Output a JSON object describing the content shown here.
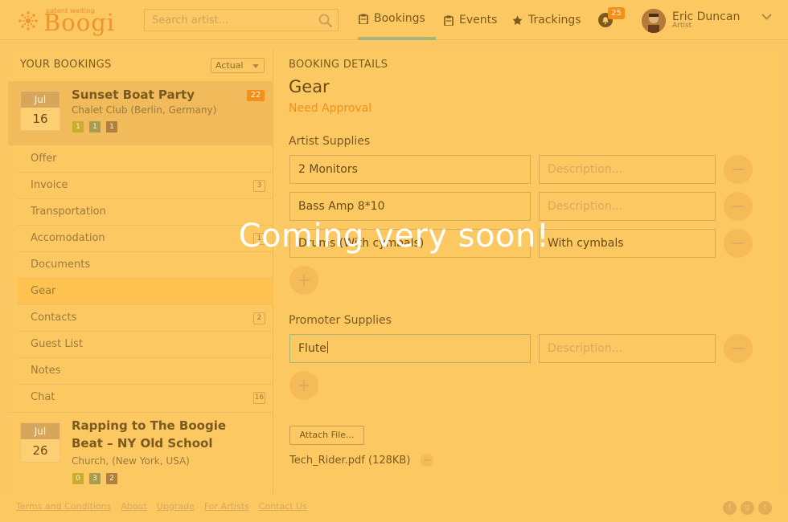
{
  "app": {
    "brand": "Boogi",
    "brand_tag": "patent waiting",
    "brand_color": "#f0932e",
    "accent_color": "#f39019",
    "overlay_text": "Coming very soon!"
  },
  "header": {
    "search_placeholder": "Search artist...",
    "tabs": [
      {
        "label": "Bookings",
        "icon": "clipboard-icon",
        "active": true
      },
      {
        "label": "Events",
        "icon": "clipboard-icon",
        "active": false
      },
      {
        "label": "Trackings",
        "icon": "star-icon",
        "active": false
      }
    ],
    "notifications_count": "25",
    "user": {
      "name": "Eric Duncan",
      "role": "Artist"
    }
  },
  "left": {
    "title": "YOUR BOOKINGS",
    "filter": "Actual",
    "bookings": [
      {
        "month": "Jul",
        "day": "16",
        "title": "Sunset Boat Party",
        "venue": "Chalet Club (Berlin, Germany)",
        "badge": "22",
        "chips": [
          "1",
          "1",
          "1"
        ]
      },
      {
        "month": "Jul",
        "day": "26",
        "title_line1": "Rapping to The Boogie",
        "title_line2": "Beat – NY Old School",
        "venue": "Church, (New York, USA)",
        "chips": [
          "0",
          "3",
          "2"
        ]
      }
    ],
    "menu": [
      {
        "label": "Offer",
        "count": ""
      },
      {
        "label": "Invoice",
        "count": "3"
      },
      {
        "label": "Transportation",
        "count": ""
      },
      {
        "label": "Accomodation",
        "count": "1"
      },
      {
        "label": "Documents",
        "count": ""
      },
      {
        "label": "Gear",
        "count": "",
        "active": true
      },
      {
        "label": "Contacts",
        "count": "2"
      },
      {
        "label": "Guest List",
        "count": ""
      },
      {
        "label": "Notes",
        "count": ""
      },
      {
        "label": "Chat",
        "count": "16"
      }
    ]
  },
  "details": {
    "title": "BOOKING DETAILS",
    "heading": "Gear",
    "status": "Need Approval",
    "artist_section": "Artist Supplies",
    "artist_items": [
      {
        "value": "2 Monitors",
        "description": "",
        "desc_placeholder": "Description..."
      },
      {
        "value": "Bass Amp 8*10",
        "description": "",
        "desc_placeholder": "Description..."
      },
      {
        "value": "Drums (With cymbals)",
        "description": "With cymbals",
        "desc_placeholder": "Description..."
      }
    ],
    "promoter_section": "Promoter Supplies",
    "promoter_items": [
      {
        "value": "Flute",
        "description": "",
        "desc_placeholder": "Description..."
      }
    ],
    "attach_label": "Attach File...",
    "file_name": "Tech_Rider.pdf (128KB)"
  },
  "footer": {
    "links": [
      "Terms and Conditions",
      "About",
      "Upgrade",
      "For Artists",
      "Contact Us"
    ],
    "social": [
      "facebook-icon",
      "google-plus-icon",
      "twitter-icon"
    ]
  }
}
